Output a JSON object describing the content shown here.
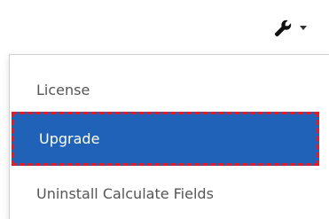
{
  "toolbar": {
    "tools_icon": "wrench-icon",
    "caret_icon": "caret-down-icon"
  },
  "menu": {
    "items": [
      {
        "label": "License"
      },
      {
        "label": "Upgrade",
        "selected": true
      },
      {
        "label": "Uninstall Calculate Fields"
      }
    ]
  },
  "colors": {
    "highlight_background": "#2062b8",
    "highlight_border": "#e21d2a",
    "item_text": "#555555"
  }
}
